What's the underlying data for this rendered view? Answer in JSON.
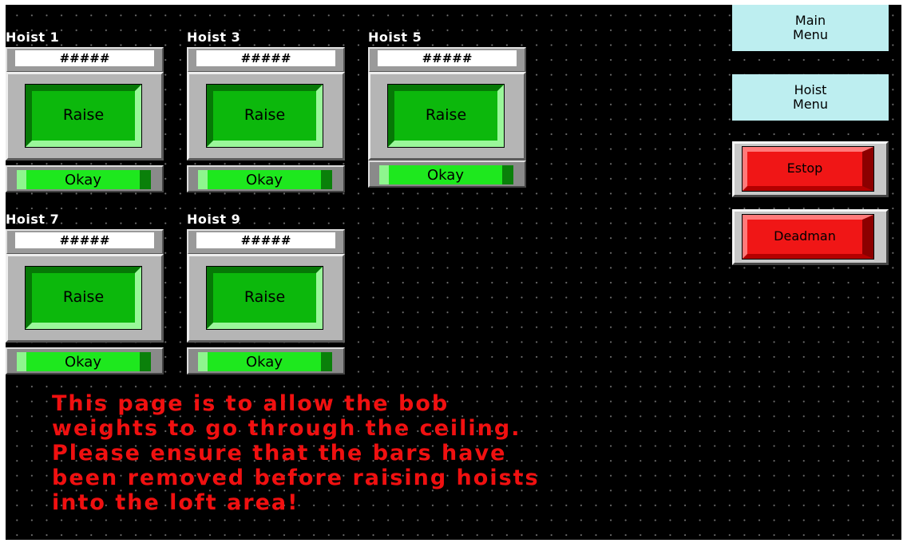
{
  "hoists": [
    {
      "label": "Hoist 1",
      "readout": "#####",
      "button": "Raise",
      "status": "Okay"
    },
    {
      "label": "Hoist 3",
      "readout": "#####",
      "button": "Raise",
      "status": "Okay"
    },
    {
      "label": "Hoist 5",
      "readout": "#####",
      "button": "Raise",
      "status": "Okay"
    },
    {
      "label": "Hoist 7",
      "readout": "#####",
      "button": "Raise",
      "status": "Okay"
    },
    {
      "label": "Hoist 9",
      "readout": "#####",
      "button": "Raise",
      "status": "Okay"
    }
  ],
  "menu": {
    "main_menu": "Main\nMenu",
    "hoist_menu": "Hoist\nMenu"
  },
  "controls": {
    "estop": "Estop",
    "deadman": "Deadman"
  },
  "message": "This page is to allow the bob\nweights to go through the ceiling.\nPlease ensure that the bars have\nbeen removed before raising hoists\ninto the loft area!",
  "colors": {
    "background": "#000000",
    "raise_green": "#0cb80c",
    "status_green": "#1ee81e",
    "menu_cyan": "#bdeef0",
    "alarm_red": "#f01616",
    "message_red": "#f01010"
  }
}
